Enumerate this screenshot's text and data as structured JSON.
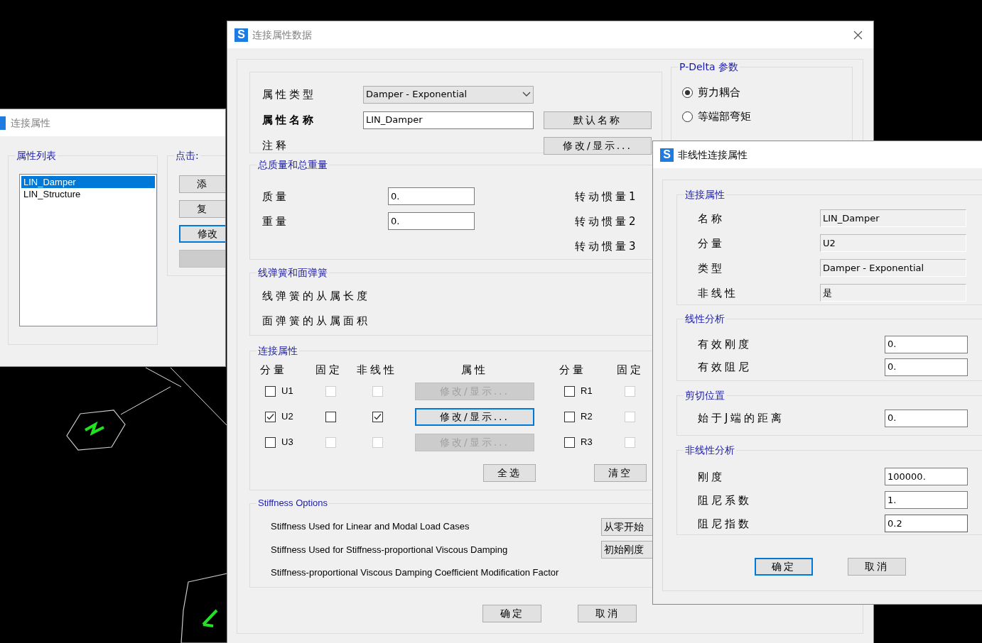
{
  "left_window": {
    "title": "连接属性",
    "list_group": {
      "title": "属性列表",
      "items": [
        {
          "label": "LIN_Damper",
          "selected": true
        },
        {
          "label": "LIN_Structure",
          "selected": false
        }
      ]
    },
    "click_group": {
      "title": "点击:",
      "buttons": [
        {
          "label": "添",
          "disabled": false,
          "focused": false
        },
        {
          "label": "复",
          "disabled": false,
          "focused": false
        },
        {
          "label": "修改",
          "disabled": false,
          "focused": true
        },
        {
          "disabled": true,
          "focused": false
        }
      ]
    }
  },
  "main_window": {
    "icon_letter": "S",
    "title": "连接属性数据",
    "property_type": {
      "label": "属性类型",
      "value": "Damper - Exponential"
    },
    "property_name": {
      "label": "属性名称",
      "value": "LIN_Damper",
      "button": "默认名称"
    },
    "notes": {
      "label": "注释",
      "button": "修改/显示..."
    },
    "mass_weight": {
      "title": "总质量和总重量",
      "fields": [
        {
          "label": "质量",
          "value": "0."
        },
        {
          "label": "重量",
          "value": "0."
        }
      ],
      "inertia_labels": [
        "转动惯量1",
        "转动惯量2",
        "转动惯量3"
      ]
    },
    "springs": {
      "title": "线弹簧和面弹簧",
      "labels": [
        "线弹簧的从属长度",
        "面弹簧的从属面积"
      ]
    },
    "link_properties": {
      "title": "连接属性",
      "headers": [
        "分量",
        "固定",
        "非线性",
        "属性",
        "分量",
        "固定"
      ],
      "rows": [
        {
          "dof": "U1",
          "checked": false,
          "fixed": false,
          "fixed_disabled": true,
          "nonlinear": false,
          "nonlinear_disabled": true,
          "button": "修改/显示...",
          "button_disabled": true,
          "button_focused": false,
          "rot_dof": "R1",
          "rot_checked": false,
          "rot_fixed": false,
          "rot_fixed_disabled": true
        },
        {
          "dof": "U2",
          "checked": true,
          "fixed": false,
          "fixed_disabled": false,
          "nonlinear": true,
          "nonlinear_disabled": false,
          "button": "修改/显示...",
          "button_disabled": false,
          "button_focused": true,
          "rot_dof": "R2",
          "rot_checked": false,
          "rot_fixed": false,
          "rot_fixed_disabled": true
        },
        {
          "dof": "U3",
          "checked": false,
          "fixed": false,
          "fixed_disabled": true,
          "nonlinear": false,
          "nonlinear_disabled": true,
          "button": "修改/显示...",
          "button_disabled": true,
          "button_focused": false,
          "rot_dof": "R3",
          "rot_checked": false,
          "rot_fixed": false,
          "rot_fixed_disabled": true
        }
      ],
      "select_all": "全选",
      "clear": "清空"
    },
    "stiffness_options": {
      "title": "Stiffness Options",
      "rows": [
        {
          "label": "Stiffness Used for Linear and Modal Load Cases",
          "value": "从零开始"
        },
        {
          "label": "Stiffness Used for Stiffness-proportional Viscous Damping",
          "value": "初始刚度"
        },
        {
          "label": "Stiffness-proportional Viscous Damping Coefficient Modification Factor"
        }
      ]
    },
    "buttons": [
      "确定",
      "取消"
    ],
    "p_delta": {
      "title": "P-Delta 参数",
      "options": [
        {
          "label": "剪力耦合",
          "selected": true
        },
        {
          "label": "等端部弯矩",
          "selected": false
        }
      ]
    }
  },
  "nonlinear_window": {
    "icon_letter": "S",
    "title": "非线性连接属性",
    "groups": [
      {
        "title": "连接属性",
        "kind": "readonly",
        "fields": [
          {
            "label": "名称",
            "value": "LIN_Damper",
            "focused": false
          },
          {
            "label": "分量",
            "value": "U2",
            "focused": false
          },
          {
            "label": "类型",
            "value": "Damper - Exponential",
            "focused": false
          },
          {
            "label": "非线性",
            "value": "是",
            "focused": false
          }
        ]
      },
      {
        "title": "线性分析",
        "kind": "input",
        "fields": [
          {
            "label": "有效刚度",
            "value": "0.",
            "focused": false
          },
          {
            "label": "有效阻尼",
            "value": "0.",
            "focused": false
          }
        ]
      },
      {
        "title": "剪切位置",
        "kind": "input",
        "fields": [
          {
            "label": "始于J端的距离",
            "value": "0.",
            "focused": false
          }
        ]
      },
      {
        "title": "非线性分析",
        "kind": "input",
        "fields": [
          {
            "label": "刚度",
            "value": "100000.",
            "focused": false
          },
          {
            "label": "阻尼系数",
            "value": "1.",
            "focused": false
          },
          {
            "label": "阻尼指数",
            "value": "0.2",
            "focused": true
          }
        ]
      }
    ],
    "buttons": [
      {
        "label": "确定",
        "focused": true
      },
      {
        "label": "取消",
        "focused": false
      }
    ]
  }
}
